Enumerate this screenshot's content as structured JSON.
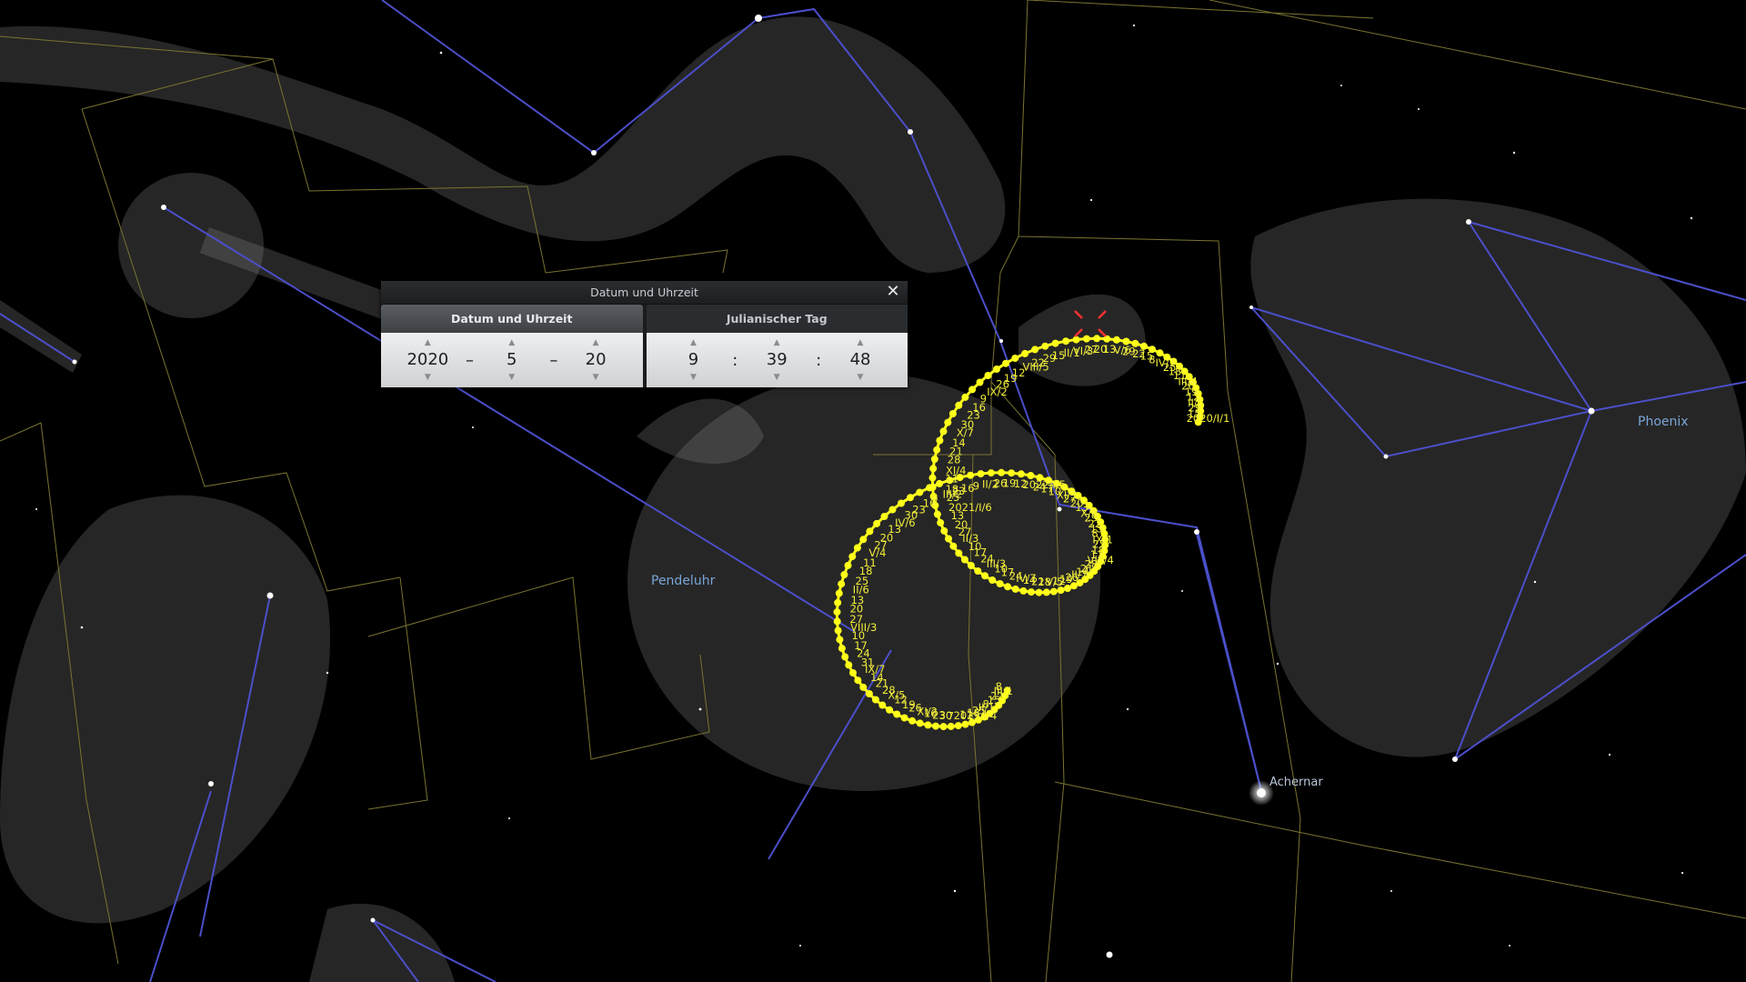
{
  "sky": {
    "constellation_names": [
      "Pendeluhr",
      "Phoenix"
    ],
    "star_names": [
      "Achernar"
    ],
    "colors": {
      "background": "#000000",
      "constellation_lines": "#4b4fc9",
      "boundaries": "#7a7430",
      "ephemeris_track": "#ffff1a",
      "labels": "#f2ee3a"
    },
    "track_labels": [
      "2020/I/1",
      "15",
      "29",
      "II/5",
      "12",
      "19",
      "26",
      "III/4",
      "11",
      "18",
      "25",
      "IV/1",
      "8",
      "15",
      "22",
      "29",
      "V/6",
      "13",
      "20",
      "27",
      "VI/3",
      "II/1",
      "15",
      "29",
      "22",
      "VIII/5",
      "12",
      "19",
      "26",
      "IX/2",
      "9",
      "16",
      "23",
      "30",
      "X/7",
      "14",
      "21",
      "28",
      "XI/4",
      "11",
      "18",
      "25",
      "2021/I/6",
      "13",
      "20",
      "27",
      "II/3",
      "10",
      "17",
      "24",
      "III/3",
      "10",
      "17",
      "24",
      "IV/7",
      "14",
      "21",
      "28",
      "V/5",
      "12",
      "19",
      "26",
      "II/7",
      "14",
      "21",
      "28",
      "VIII/4",
      "11",
      "18",
      "25",
      "IX/1",
      "8",
      "15",
      "22",
      "29",
      "X/6",
      "13",
      "20",
      "27",
      "XI/3",
      "10",
      "17",
      "24",
      "2022/I/5",
      "12",
      "19",
      "26",
      "II/2",
      "9",
      "16",
      "23",
      "III/2",
      "9",
      "16",
      "23",
      "30",
      "IV/6",
      "13",
      "20",
      "27",
      "V/4",
      "11",
      "18",
      "25",
      "II/6",
      "13",
      "20",
      "27",
      "VIII/3",
      "10",
      "17",
      "24",
      "31",
      "IX/7",
      "14",
      "21",
      "28",
      "X/5",
      "12",
      "19",
      "26",
      "XI/2",
      "16",
      "23",
      "30",
      "7",
      "2023/I/4",
      "11",
      "18",
      "25",
      "II/1",
      "8",
      "15",
      "22",
      "III/1",
      "8"
    ]
  },
  "dialog": {
    "title": "Datum und Uhrzeit",
    "close_icon": "close-icon",
    "tabs": [
      {
        "label": "Datum und Uhrzeit",
        "active": true
      },
      {
        "label": "Julianischer Tag",
        "active": false
      }
    ],
    "date": {
      "year": "2020",
      "month": "5",
      "day": "20",
      "separator": "–"
    },
    "time": {
      "hour": "9",
      "minute": "39",
      "second": "48",
      "separator": ":"
    }
  }
}
